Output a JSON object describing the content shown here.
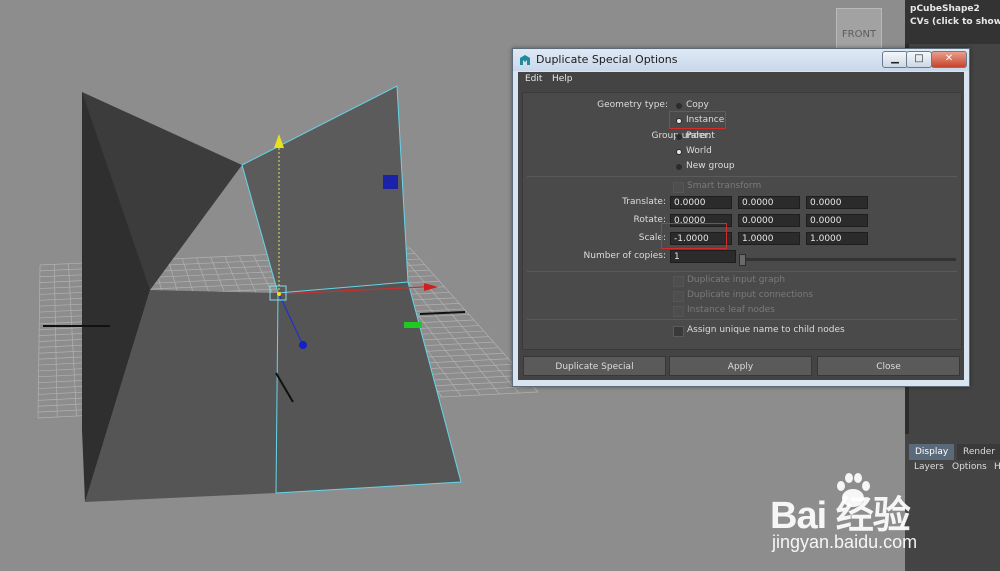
{
  "viewport": {
    "view_cube_label": "FRONT"
  },
  "attribute_panel": {
    "title": "pCubeShape2",
    "subtitle": "CVs (click to show)"
  },
  "layer_editor": {
    "tabs": [
      "Display",
      "Render"
    ],
    "menu": [
      "Layers",
      "Options",
      "H"
    ]
  },
  "dialog": {
    "title": "Duplicate Special Options",
    "window_buttons": {
      "minimize": "▁",
      "maximize": "□",
      "close": "✕"
    },
    "menu": {
      "edit": "Edit",
      "help": "Help"
    },
    "geometry_type": {
      "label": "Geometry type:",
      "options": [
        "Copy",
        "Instance"
      ],
      "selected": "Instance"
    },
    "group_under": {
      "label": "Group under:",
      "options": [
        "Parent",
        "World",
        "New group"
      ],
      "selected": "World"
    },
    "smart_transform": {
      "label": "Smart transform",
      "checked": false,
      "enabled": false
    },
    "translate": {
      "label": "Translate:",
      "values": [
        "0.0000",
        "0.0000",
        "0.0000"
      ]
    },
    "rotate": {
      "label": "Rotate:",
      "values": [
        "0.0000",
        "0.0000",
        "0.0000"
      ]
    },
    "scale": {
      "label": "Scale:",
      "values": [
        "-1.0000",
        "1.0000",
        "1.0000"
      ]
    },
    "copies": {
      "label": "Number of copies:",
      "value": "1"
    },
    "checkboxes": [
      {
        "label": "Duplicate input graph",
        "enabled": false
      },
      {
        "label": "Duplicate input connections",
        "enabled": false
      },
      {
        "label": "Instance leaf nodes",
        "enabled": false
      },
      {
        "label": "Assign unique name to child nodes",
        "enabled": true
      }
    ],
    "buttons": {
      "duplicate": "Duplicate Special",
      "apply": "Apply",
      "close": "Close"
    }
  },
  "watermark": {
    "brand": "Bai 经验",
    "url": "jingyan.baidu.com"
  }
}
